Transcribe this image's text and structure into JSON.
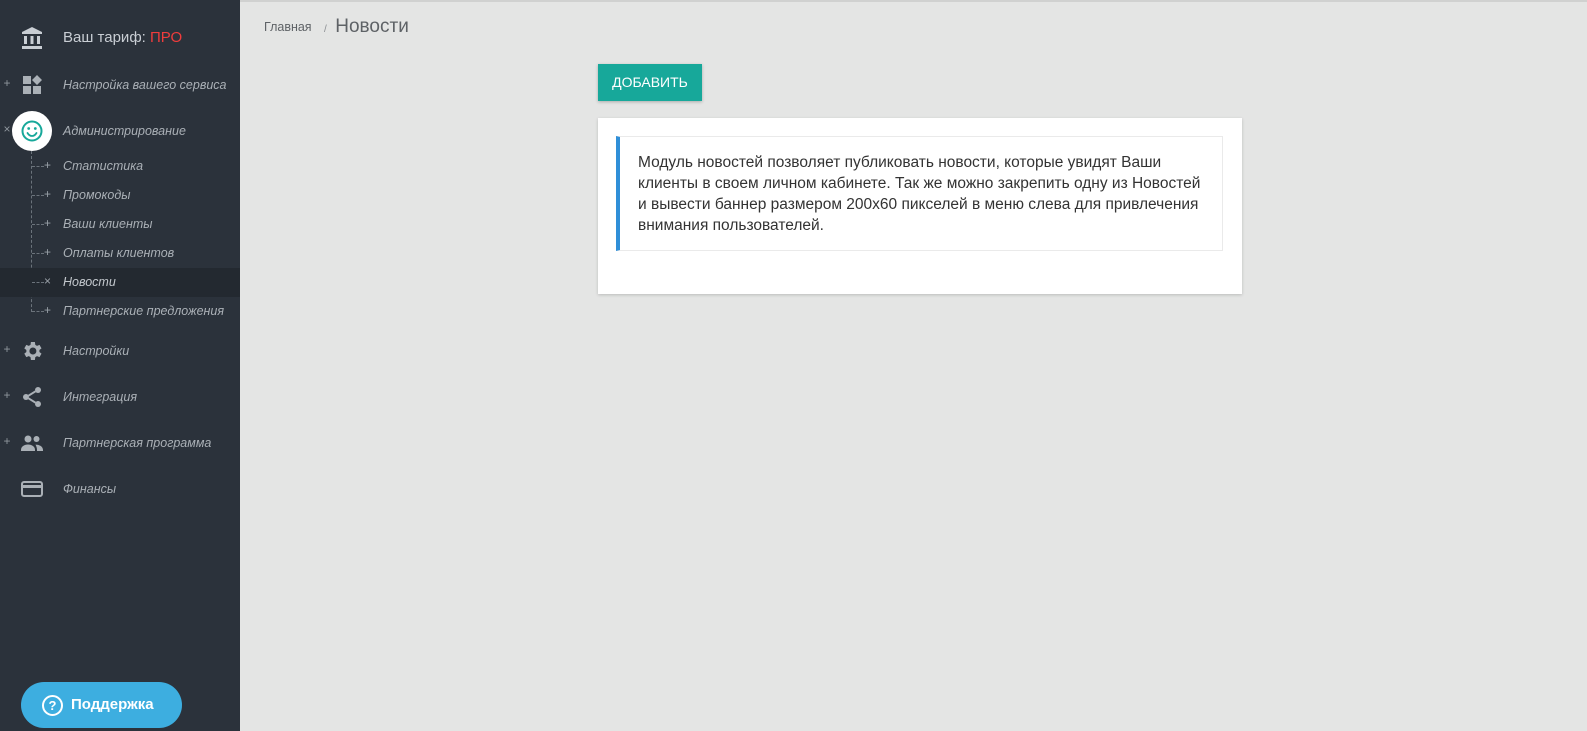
{
  "sidebar": {
    "tariff_prefix": "Ваш тариф:",
    "tariff_plan": "ПРО",
    "plan_color": "#f03c3c",
    "items": [
      {
        "label": "Настройка вашего сервиса",
        "toggle": "+",
        "icon": "dashboard-icon"
      },
      {
        "label": "Администрирование",
        "toggle": "×",
        "icon": "smiley-icon"
      },
      {
        "label": "Настройки",
        "toggle": "+",
        "icon": "gear-icon"
      },
      {
        "label": "Интеграция",
        "toggle": "+",
        "icon": "share-icon"
      },
      {
        "label": "Партнерская программа",
        "toggle": "+",
        "icon": "people-icon"
      },
      {
        "label": "Финансы",
        "toggle": "",
        "icon": "credit-card-icon"
      }
    ],
    "admin_subitems": [
      {
        "label": "Статистика",
        "toggle": "+"
      },
      {
        "label": "Промокоды",
        "toggle": "+"
      },
      {
        "label": "Ваши клиенты",
        "toggle": "+"
      },
      {
        "label": "Оплаты клиентов",
        "toggle": "+"
      },
      {
        "label": "Новости",
        "toggle": "×",
        "active": true
      },
      {
        "label": "Партнерские предложения",
        "toggle": "+"
      }
    ],
    "support_label": "Поддержка",
    "support_icon_glyph": "?"
  },
  "breadcrumb": {
    "home": "Главная",
    "separator": "/",
    "current": "Новости"
  },
  "main": {
    "add_button_label": "Добавить",
    "info_text": "Модуль новостей позволяет публиковать новости, которые увидят Ваши клиенты в своем личном кабинете. Так же можно закрепить одну из Новостей и вывести баннер размером 200x60 пикселей в меню слева для привлечения внимания пользователей."
  },
  "colors": {
    "sidebar_bg": "#2b323b",
    "accent_teal": "#17a89a",
    "info_border": "#2f8fd8",
    "support_bg": "#3daee0"
  }
}
